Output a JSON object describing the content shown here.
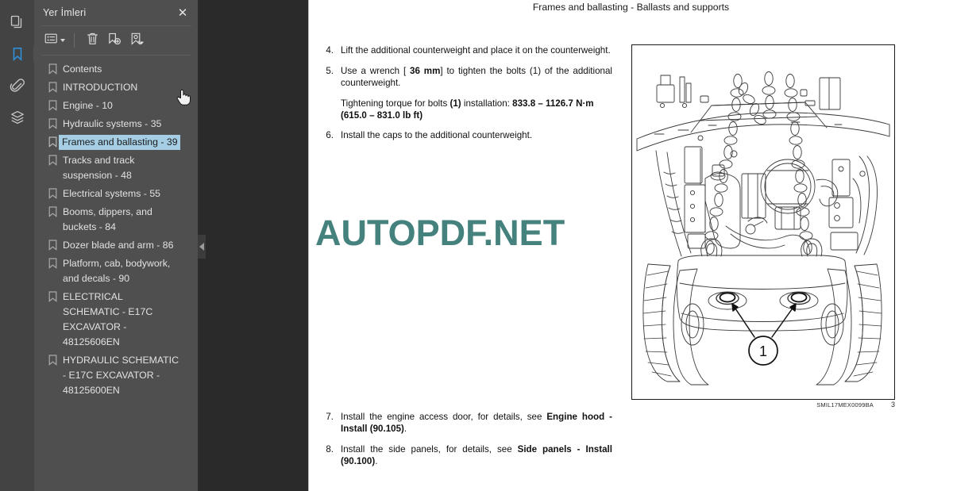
{
  "rail": {
    "items": [
      {
        "name": "page-thumbnails",
        "icon": "pages-icon",
        "active": false
      },
      {
        "name": "bookmarks",
        "icon": "bookmark-icon",
        "active": true
      },
      {
        "name": "attachments",
        "icon": "paperclip-icon",
        "active": false
      },
      {
        "name": "layers",
        "icon": "layers-icon",
        "active": false
      }
    ]
  },
  "panel": {
    "title": "Yer İmleri",
    "close_label": "✕",
    "toolbar": [
      {
        "name": "list-options-button",
        "icon": "list-options-icon",
        "has_caret": true
      },
      {
        "name": "delete-bookmark-button",
        "icon": "trash-icon",
        "has_caret": false
      },
      {
        "name": "new-bookmark-button",
        "icon": "bookmark-add-icon",
        "has_caret": false
      },
      {
        "name": "edit-bookmark-button",
        "icon": "bookmark-edit-icon",
        "has_caret": false
      }
    ],
    "bookmarks": [
      {
        "label": "Contents",
        "selected": false
      },
      {
        "label": "INTRODUCTION",
        "selected": false
      },
      {
        "label": "Engine - 10",
        "selected": false
      },
      {
        "label": "Hydraulic systems - 35",
        "selected": false
      },
      {
        "label": "Frames and ballasting - 39",
        "selected": true
      },
      {
        "label": "Tracks and track suspension - 48",
        "selected": false
      },
      {
        "label": "Electrical systems - 55",
        "selected": false
      },
      {
        "label": "Booms, dippers, and buckets - 84",
        "selected": false
      },
      {
        "label": "Dozer blade and arm - 86",
        "selected": false
      },
      {
        "label": "Platform, cab, bodywork, and decals - 90",
        "selected": false
      },
      {
        "label": "ELECTRICAL SCHEMATIC - E17C EXCAVATOR - 48125606EN",
        "selected": false
      },
      {
        "label": "HYDRAULIC SCHEMATIC - E17C EXCAVATOR - 48125600EN",
        "selected": false
      }
    ]
  },
  "document": {
    "header": "Frames and ballasting - Ballasts and supports",
    "watermark": "AUTOPDF.NET",
    "steps": [
      {
        "num": "4.",
        "html": "Lift the additional counterweight and place it on the counterweight."
      },
      {
        "num": "5.",
        "html": "Use a wrench [ <b>36 mm</b>] to tighten the bolts (1) of the additional counterweight."
      },
      {
        "num": "6.",
        "html": "Install the caps to the additional counterweight."
      }
    ],
    "torque_note": "Tightening torque for bolts <b>(1)</b> installation: <b>833.8 – 1126.7 N·m (615.0 – 831.0 lb ft)</b>",
    "steps_bottom": [
      {
        "num": "7.",
        "html": "Install the engine access door, for details, see <b>Engine hood - Install (90.105)</b>."
      },
      {
        "num": "8.",
        "html": "Install the side panels, for details, see <b>Side panels - Install (90.100)</b>."
      }
    ],
    "figure": {
      "caption_code": "SMIL17MEX0099BA",
      "page_number": "3",
      "callout": "1"
    }
  },
  "colors": {
    "rail_bg": "#434343",
    "panel_bg": "#4f4f4f",
    "viewer_bg": "#2a2a2a",
    "page_bg": "#ffffff",
    "accent": "#2e8fd8",
    "selection": "#a5cee4",
    "watermark": "#45827e"
  }
}
